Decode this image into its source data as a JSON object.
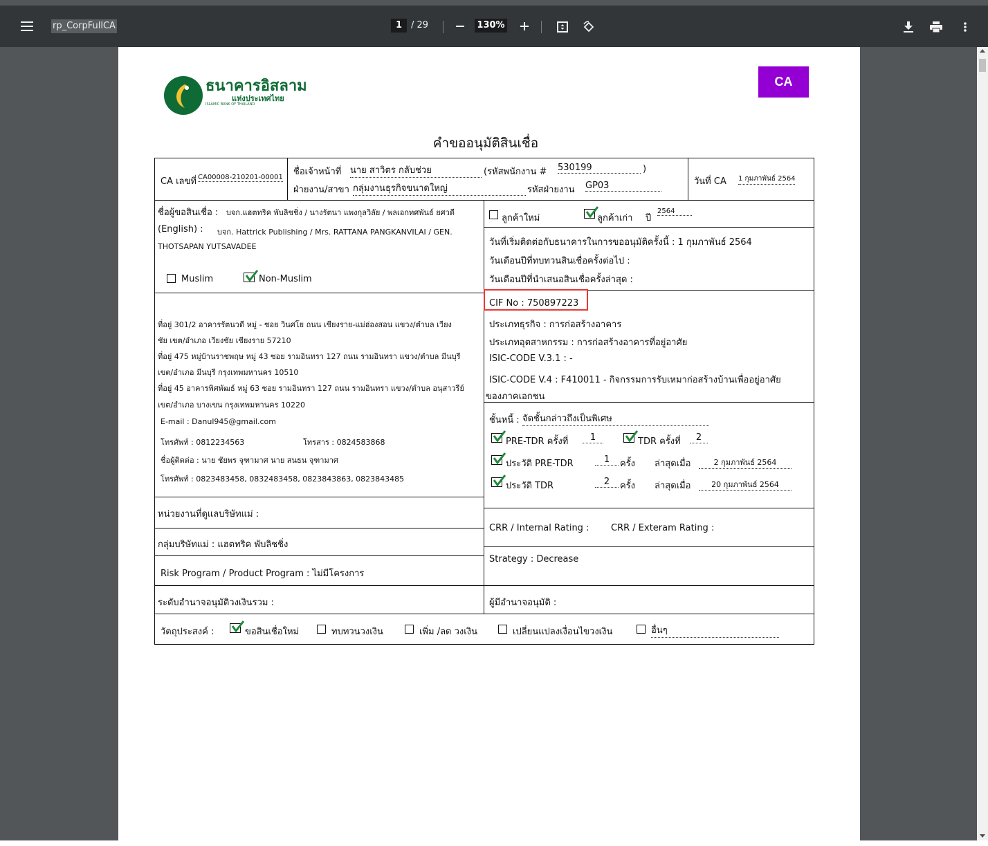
{
  "toolbar": {
    "title": "rp_CorpFullCA",
    "page_current": "1",
    "page_total": "/ 29",
    "zoom": "130%"
  },
  "header": {
    "logo_text_th": "ธนาคารอิสลาม",
    "logo_text_sub": "แห่งประเทศไทย",
    "logo_text_en": "ISLAMIC BANK OF THAILAND",
    "badge": "CA",
    "badge_color": "#9400d3",
    "form_title": "คำขออนุมัติสินเชื่อ"
  },
  "ca_info": {
    "ca_no_label": "CA เลขที่",
    "ca_no": "CA00008-210201-00001",
    "officer_label": "ชื่อเจ้าหน้าที่",
    "officer": "นาย สาวิตร กลับช่วย",
    "emp_code_label": "(รหัสพนักงาน #",
    "emp_code": "530199",
    "emp_code_close": ")",
    "dept_label": "ฝ่ายงาน/สาขา",
    "dept": "กลุ่มงานธุรกิจขนาดใหญ่",
    "dept_code_label": "รหัสฝ่ายงาน",
    "dept_code": "GP03",
    "ca_date_label": "วันที่ CA",
    "ca_date": "1 กุมภาพันธ์ 2564"
  },
  "borrower": {
    "name_label": "ชื่อผู้ขอสินเชื่อ : ",
    "name_th": "บจก.แฮตทริค พับลิชชิ่ง / นางรัตนา แพงกุลวิลัย / พลเอกทศพันธ์ ยศวดี",
    "english_label": "(English) : ",
    "name_en_1": "บจก. Hattrick Publishing / Mrs. RATTANA PANGKANVILAI / GEN.",
    "name_en_2": "THOTSAPAN YUTSAVADEE",
    "muslim": "Muslim",
    "non_muslim": "Non-Muslim"
  },
  "customer": {
    "new_customer": "ลูกค้าใหม่",
    "old_customer": "ลูกค้าเก่า",
    "year_label": "ปี",
    "year": "2564",
    "contact_date": "วันที่เริ่มติดต่อกับธนาคารในการขออนุมัติครั้งนี้ : 1 กุมภาพันธ์ 2564",
    "next_review": "วันเดือนปีที่ทบทวนสินเชื่อครั้งต่อไป :",
    "last_present": "วันเดือนปีที่นำเสนอสินเชื่อครั้งล่าสุด :"
  },
  "addresses": [
    "ที่อยู่ 301/2 อาคารรัตนวดี หมู่ - ซอย วินศโย ถนน เชียงราย-แม่ฮ่องสอน แขวง/ตำบล เวียง",
    "ชัย เขต/อำเภอ เวียงชัย เชียงราย 57210",
    "ที่อยู่ 475  หมู่บ้านราชพฤษ หมู่ 43 ซอย รามอินทรา 127 ถนน รามอินทรา แขวง/ตำบล มีนบุรี",
    "เขต/อำเภอ มีนบุรี กรุงเทพมหานคร 10510",
    "ที่อยู่ 45 อาคารพิศพัฒธ์ หมู่ 63 ซอย รามอินทรา 127 ถนน รามอินทรา แขวง/ตำบล อนุสาวรีย์",
    "เขต/อำเภอ บางเขน กรุงเทพมหานคร 10220"
  ],
  "contact": {
    "email": "E-mail : Danul945@gmail.com",
    "phone": "โทรศัพท์ : 0812234563",
    "fax": "โทรสาร : 0824583868",
    "contact_person": "ชื่อผู้ติดต่อ : นาย ชัยพร  จุฑามาศ นาย สนธน จุฑามาศ",
    "phones": "โทรศัพท์ : 0823483458, 0832483458, 0823843863, 0823843485"
  },
  "business": {
    "cif": "CIF No : 750897223",
    "type": "ประเภทธุรกิจ : การก่อสร้างอาคาร",
    "industry": "ประเภทอุตสาหกรรม : การก่อสร้างอาคารที่อยู่อาศัย",
    "isic3": "ISIC-CODE V.3.1 : -",
    "isic4": "ISIC-CODE V.4 : F410011 - กิจกรรมการรับเหมาก่อสร้างบ้านเพื่ออยู่อาศัย",
    "isic4_cont": "ของภาคเอกชน",
    "highlight_color": "#e53935"
  },
  "debt": {
    "class_label": "ชั้นหนี้ :",
    "class_value": "จัดชั้นกล่าวถึงเป็นพิเศษ",
    "pre_tdr_label": "PRE-TDR ครั้งที่",
    "pre_tdr_count": "1",
    "tdr_label": "TDR ครั้งที่",
    "tdr_count": "2",
    "hist_pre_tdr_label": "ประวัติ PRE-TDR",
    "hist_pre_tdr_count": "1",
    "hist_pre_tdr_unit": "ครั้ง",
    "hist_pre_tdr_last_label": "ล่าสุดเมื่อ",
    "hist_pre_tdr_last": "2 กุมภาพันธ์ 2564",
    "hist_tdr_label": "ประวัติ TDR",
    "hist_tdr_count": "2",
    "hist_tdr_unit": "ครั้ง",
    "hist_tdr_last_label": "ล่าสุดเมื่อ",
    "hist_tdr_last": "20 กุมภาพันธ์ 2564"
  },
  "misc": {
    "parent_unit": "หน่วยงานที่ดูแลบริษัทแม่ :",
    "parent_group": "กลุ่มบริษัทแม่ : แฮตทริค พับลิชชิ่ง",
    "risk_program": "Risk Program / Product Program : ไม่มีโครงการ",
    "approval_level": "ระดับอำนาจอนุมัติวงเงินรวม :",
    "crr_internal": "CRR / Internal Rating :",
    "crr_external": "CRR / Exteram Rating :",
    "strategy": "Strategy : Decrease",
    "approver": "ผู้มีอำนาจอนุมัติ :"
  },
  "purpose": {
    "label": "วัตถุประสงค์ :",
    "options": [
      "ขอสินเชื่อใหม่",
      "ทบทวนวงเงิน",
      "เพิ่ม /ลด วงเงิน",
      "เปลี่ยนแปลงเงื่อนไขวงเงิน",
      "อื่นๆ"
    ]
  },
  "icons": [
    "menu-icon",
    "zoom-out-icon",
    "zoom-in-icon",
    "fit-page-icon",
    "rotate-icon",
    "download-icon",
    "print-icon",
    "more-icon",
    "checkbox-checked-icon",
    "checkbox-empty-icon"
  ]
}
